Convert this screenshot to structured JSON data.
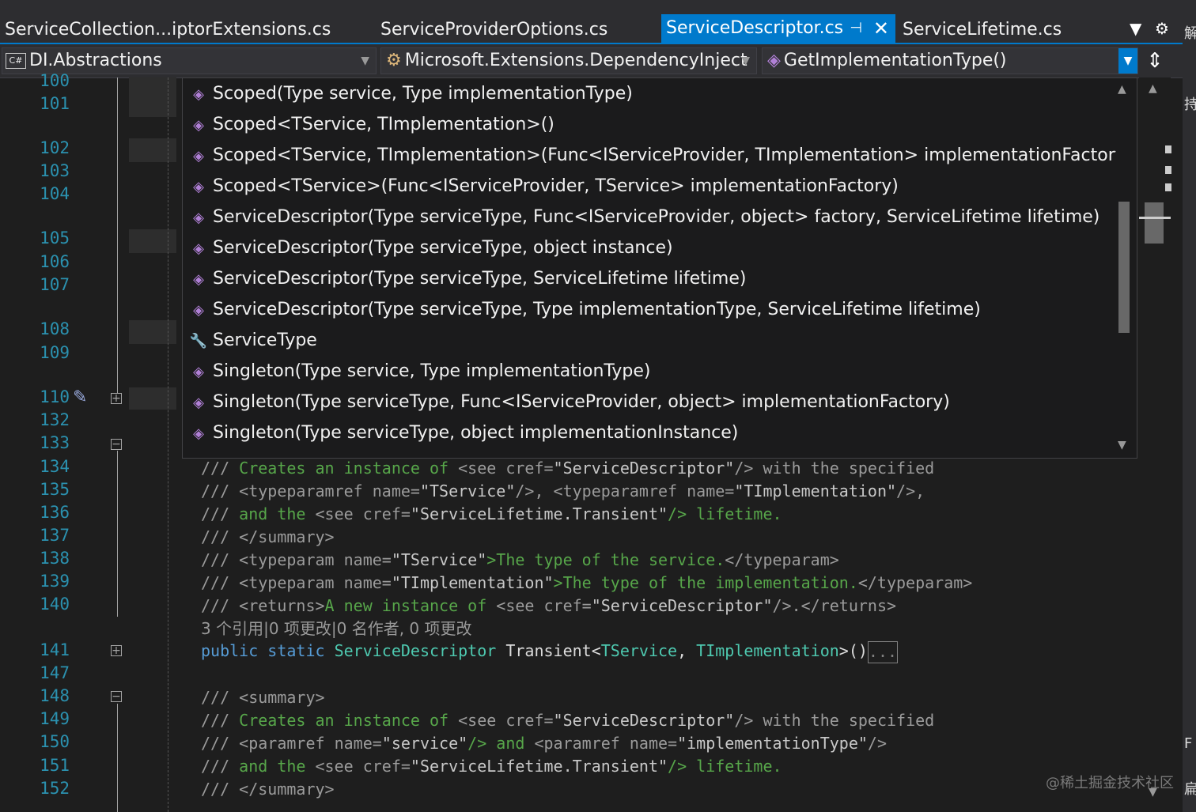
{
  "tabs": [
    {
      "label": "ServiceCollection...iptorExtensions.cs",
      "active": false
    },
    {
      "label": "ServiceProviderOptions.cs",
      "active": false
    },
    {
      "label": "ServiceDescriptor.cs",
      "active": true
    },
    {
      "label": "ServiceLifetime.cs",
      "active": false
    }
  ],
  "tab_icons": {
    "pin": "pin-icon",
    "close": "close-icon",
    "dropdown": "tab-list-icon",
    "settings": "gear-icon"
  },
  "nav": {
    "project_badge": "C#",
    "project": "DI.Abstractions",
    "type": "Microsoft.Extensions.DependencyInject",
    "member": "GetImplementationType()"
  },
  "dropdown_items": [
    {
      "icon": "method-icon",
      "label": "Scoped(Type service, Type implementationType)"
    },
    {
      "icon": "method-icon",
      "label": "Scoped<TService, TImplementation>()"
    },
    {
      "icon": "method-icon",
      "label": "Scoped<TService, TImplementation>(Func<IServiceProvider, TImplementation> implementationFactory)"
    },
    {
      "icon": "method-icon",
      "label": "Scoped<TService>(Func<IServiceProvider, TService> implementationFactory)"
    },
    {
      "icon": "method-icon",
      "label": "ServiceDescriptor(Type serviceType, Func<IServiceProvider, object> factory, ServiceLifetime lifetime)"
    },
    {
      "icon": "method-icon",
      "label": "ServiceDescriptor(Type serviceType, object instance)"
    },
    {
      "icon": "private-method-icon",
      "label": "ServiceDescriptor(Type serviceType, ServiceLifetime lifetime)"
    },
    {
      "icon": "method-icon",
      "label": "ServiceDescriptor(Type serviceType, Type implementationType, ServiceLifetime lifetime)"
    },
    {
      "icon": "property-wrench-icon",
      "label": "ServiceType"
    },
    {
      "icon": "method-icon",
      "label": "Singleton(Type service, Type implementationType)"
    },
    {
      "icon": "method-icon",
      "label": "Singleton(Type serviceType, Func<IServiceProvider, object> implementationFactory)"
    },
    {
      "icon": "method-icon",
      "label": "Singleton(Type serviceType, object implementationInstance)"
    }
  ],
  "line_numbers": [
    "100",
    "101",
    "102",
    "103",
    "104",
    "105",
    "106",
    "107",
    "108",
    "109",
    "110",
    "132",
    "133",
    "134",
    "135",
    "136",
    "137",
    "138",
    "139",
    "140",
    "141",
    "147",
    "148",
    "149",
    "150",
    "151",
    "152"
  ],
  "code": {
    "l134": [
      "/// ",
      "Creates an instance of ",
      "<see cref=",
      "\"ServiceDescriptor\"",
      "/> with the specified"
    ],
    "l135": [
      "/// ",
      "<typeparamref name=",
      "\"TService\"",
      "/>, ",
      "<typeparamref name=",
      "\"TImplementation\"",
      "/>,"
    ],
    "l136": [
      "/// ",
      "and the ",
      "<see cref=",
      "\"ServiceLifetime.Transient\"",
      "/> lifetime."
    ],
    "l137": [
      "/// ",
      "</summary>"
    ],
    "l138": [
      "/// ",
      "<typeparam name=",
      "\"TService\"",
      ">The type of the service.",
      "</typeparam>"
    ],
    "l139": [
      "/// ",
      "<typeparam name=",
      "\"TImplementation\"",
      ">The type of the implementation.",
      "</typeparam>"
    ],
    "l140": [
      "/// ",
      "<returns>",
      "A new instance of ",
      "<see cref=",
      "\"ServiceDescriptor\"",
      "/>.",
      "</returns>"
    ],
    "codelens": "3 个引用|0 项更改|0 名作者, 0 项更改",
    "l141": [
      "public",
      " ",
      "static",
      " ",
      "ServiceDescriptor",
      " Transient<",
      "TService",
      ", ",
      "TImplementation",
      ">()",
      "..."
    ],
    "l148": [
      "/// ",
      "<summary>"
    ],
    "l149": [
      "/// ",
      "Creates an instance of ",
      "<see cref=",
      "\"ServiceDescriptor\"",
      "/> with the specified"
    ],
    "l150": [
      "/// ",
      "<paramref name=",
      "\"service\"",
      "/> and ",
      "<paramref name=",
      "\"implementationType\"",
      "/>"
    ],
    "l151": [
      "/// ",
      "and the ",
      "<see cref=",
      "\"ServiceLifetime.Transient\"",
      "/> lifetime."
    ],
    "l152": [
      "/// ",
      "</summary>"
    ]
  },
  "watermark": "@稀土掘金技术社区",
  "right_strip": [
    "解",
    "持",
    "F",
    "扁"
  ]
}
